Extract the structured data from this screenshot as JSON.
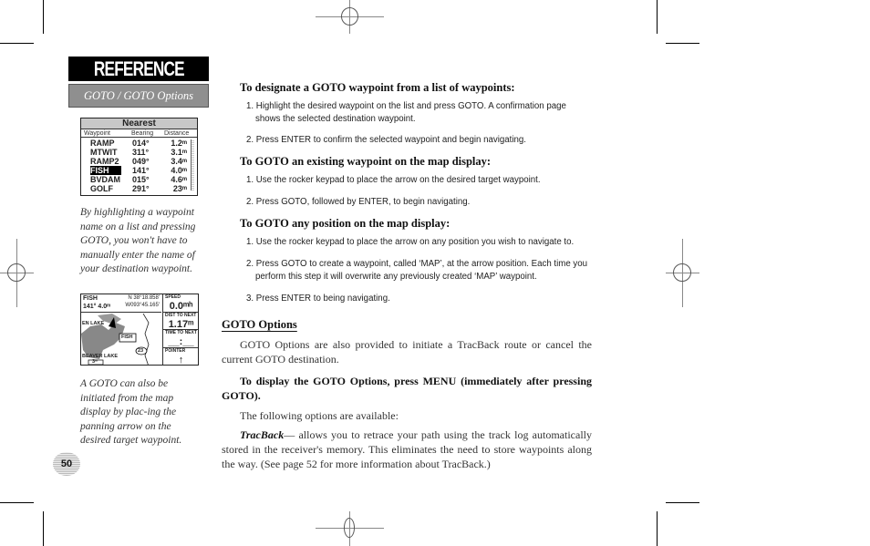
{
  "sidebar": {
    "chapter_banner": "REFERENCE",
    "section_tab": "GOTO / GOTO Options",
    "nearest_screen": {
      "title": "Nearest",
      "columns": [
        "Waypoint",
        "Bearing",
        "Distance"
      ],
      "rows": [
        {
          "name": "RAMP",
          "bearing": "014°",
          "distance": "1.2ᵐ",
          "selected": false
        },
        {
          "name": "MTWIT",
          "bearing": "311°",
          "distance": "3.1ᵐ",
          "selected": false
        },
        {
          "name": "RAMP2",
          "bearing": "049°",
          "distance": "3.4ᵐ",
          "selected": false
        },
        {
          "name": "FISH",
          "bearing": "141°",
          "distance": "4.0ᵐ",
          "selected": true
        },
        {
          "name": "BVDAM",
          "bearing": "015°",
          "distance": "4.6ᵐ",
          "selected": false
        },
        {
          "name": "GOLF",
          "bearing": "291°",
          "distance": "23ᵐ",
          "selected": false
        }
      ]
    },
    "caption_1": "By highlighting a waypoint name on a list and pressing GOTO, you won't have to manually enter the name of your destination waypoint.",
    "map_screen": {
      "waypoint": "FISH",
      "bearing_distance": "141°  4.0ᵐ",
      "lat": "N 38°18.858'",
      "lon": "W093°45.165'",
      "speed_label": "SPEED",
      "speed_value": "0.0ᵐʰ",
      "dist_label": "DIST TO NEXT",
      "dist_value": "1.17ᵐ",
      "time_label": "TIME TO NEXT",
      "time_value": "__:__",
      "pointer_label": "POINTER",
      "pointer_icon": "↑",
      "map_labels": {
        "lake_left": "EN LAKE",
        "lake_bottom": "BEAVER LAKE",
        "scale": "3ᵐ",
        "route": "23",
        "waypoint_tag": "FISH"
      }
    },
    "caption_2": "A GOTO can also be initiated from the map display by plac-ing the panning arrow on the desired target waypoint.",
    "page_number": "50"
  },
  "main": {
    "section1": {
      "heading": "To designate a GOTO waypoint from a list of waypoints:",
      "steps": [
        "1. Highlight the desired waypoint on the list and press GOTO. A confirmation page shows the selected destination waypoint.",
        "2. Press ENTER to confirm the selected waypoint and begin navigating."
      ]
    },
    "section2": {
      "heading": "To GOTO an existing waypoint on the map display:",
      "steps": [
        "1. Use the rocker keypad to place the arrow on the desired target waypoint.",
        "2. Press GOTO, followed by ENTER, to begin navigating."
      ]
    },
    "section3": {
      "heading": "To GOTO any position on the map display:",
      "steps": [
        "1. Use the rocker keypad to place the arrow on any position you wish to navigate to.",
        "2. Press GOTO to create a waypoint, called ‘MAP’, at the arrow position. Each time you perform this step it will overwrite any previously created ‘MAP’ waypoint.",
        "3. Press ENTER to being navigating."
      ]
    },
    "goto_options": {
      "heading": "GOTO Options",
      "intro": "GOTO Options are also provided to initiate a TracBack route or cancel the current GOTO destination.",
      "instruction": "To display the GOTO Options, press MENU (immediately after pressing GOTO).",
      "available": "The following options are available:",
      "tracback_term": "TracBack",
      "tracback_text": "— allows you to retrace your path using the track log automatically stored in the receiver's memory. This eliminates the need to store waypoints along the way. (See page 52 for more information about TracBack.)"
    }
  }
}
